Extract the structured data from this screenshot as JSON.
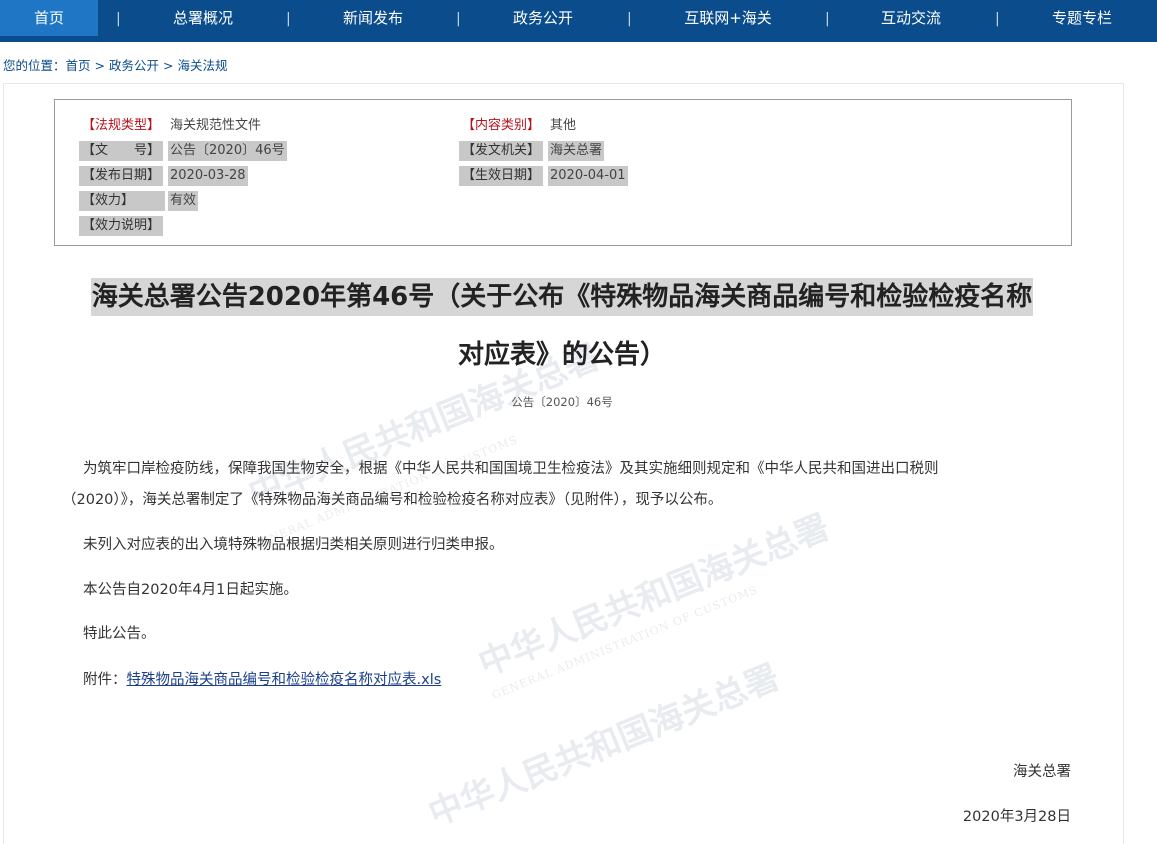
{
  "nav": {
    "items": [
      "首页",
      "总署概况",
      "新闻发布",
      "政务公开",
      "互联网+海关",
      "互动交流",
      "专题专栏"
    ],
    "separator": "|",
    "active_index": 0
  },
  "breadcrumb": {
    "prefix": "您的位置：",
    "items": [
      "首页",
      "政务公开",
      "海关法规"
    ],
    "separator": ">"
  },
  "meta": {
    "type_label": "【法规类型】",
    "type_value": "海关规范性文件",
    "category_label": "【内容类别】",
    "category_value": "其他",
    "docno_label": "【文　　号】",
    "docno_value": "公告〔2020〕46号",
    "issuer_label": "【发文机关】",
    "issuer_value": "海关总署",
    "pubdate_label": "【发布日期】",
    "pubdate_value": "2020-03-28",
    "effdate_label": "【生效日期】",
    "effdate_value": "2020-04-01",
    "validity_label": "【效力】",
    "validity_value": "有效",
    "validity_note_label": "【效力说明】"
  },
  "article": {
    "title_line1": "海关总署公告2020年第46号（关于公布《特殊物品海关商品编号和检验检疫名称",
    "title_line2": "对应表》的公告）",
    "docno": "公告〔2020〕46号",
    "para1_line1": "为筑牢口岸检疫防线，保障我国生物安全，根据《中华人民共和国国境卫生检疫法》及其实施细则规定和《中华人民共和国进出口税则",
    "para1_line2": "（2020）》，海关总署制定了《特殊物品海关商品编号和检验检疫名称对应表》（见附件），现予以公布。",
    "para2": "未列入对应表的出入境特殊物品根据归类相关原则进行归类申报。",
    "para3": "本公告自2020年4月1日起实施。",
    "para4": "特此公告。",
    "attachment_prefix": "附件：",
    "attachment_link": "特殊物品海关商品编号和检验检疫名称对应表.xls",
    "signature": "海关总署",
    "date": "2020年3月28日"
  },
  "watermark": {
    "text_cn": "中华人民共和国海关总署",
    "text_en": "GENERAL ADMINISTRATION OF CUSTOMS"
  }
}
